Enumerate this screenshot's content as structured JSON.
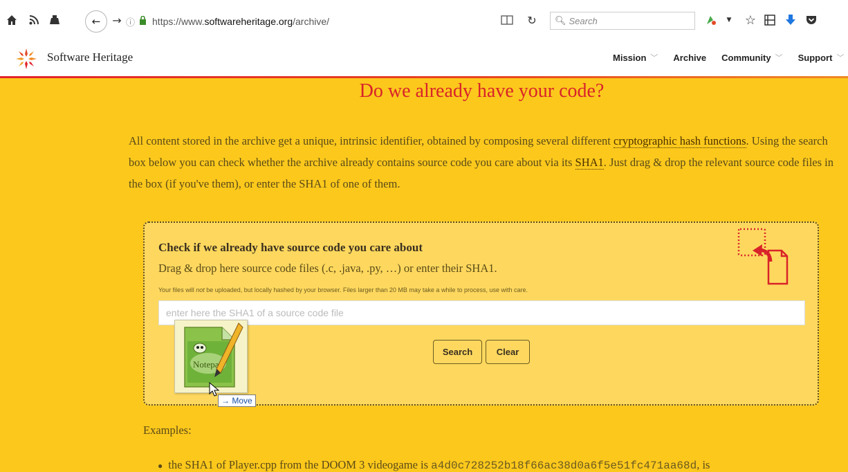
{
  "browser": {
    "url_prefix": "https://www.",
    "url_domain": "softwareheritage.org",
    "url_path": "/archive/",
    "search_placeholder": "Search",
    "icons": [
      "home-icon",
      "rss-icon",
      "user-icon",
      "back-icon",
      "forward-icon",
      "info-icon",
      "lock-icon",
      "reader-view-icon",
      "reload-icon",
      "search-icon",
      "extension-icon",
      "dropdown-icon",
      "bookmark-star-icon",
      "library-icon",
      "download-icon",
      "pocket-icon"
    ]
  },
  "site": {
    "brand": "Software Heritage",
    "nav": [
      {
        "label": "Mission",
        "has_menu": true
      },
      {
        "label": "Archive",
        "has_menu": false
      },
      {
        "label": "Community",
        "has_menu": true
      },
      {
        "label": "Support",
        "has_menu": true
      }
    ]
  },
  "page": {
    "title": "Do we already have your code?",
    "intro_1": "All content stored in the archive get a unique, intrinsic identifier, obtained by composing several different",
    "intro_link_1": "cryptographic hash functions",
    "intro_2": ". Using the search box below you can check whether the archive already contains source code you care about via its",
    "intro_link_2": "SHA1",
    "intro_3": ". Just drag & drop the relevant source code files in the box (if you've them), or enter the SHA1 of one of them.",
    "dropbox": {
      "title": "Check if we already have source code you care about",
      "subtitle": "Drag & drop here source code files (.c, .java, .py, …) or enter their SHA1.",
      "note_1": "Your files will",
      "note_em": "not",
      "note_2": "be uploaded, but locally hashed by your browser. Files larger than 20 MB may take a while to process, use with care.",
      "input_placeholder": "enter here the SHA1 of a source code file",
      "search_button": "Search",
      "clear_button": "Clear"
    },
    "drag_tooltip": "→ Move",
    "examples_label": "Examples:",
    "example_1_prefix": "the SHA1 of Player.cpp from the DOOM 3 videogame is",
    "example_1_hash": "a4d0c728252b18f66ac38d0a6f5e51fc471aa68d",
    "example_1_suffix": ", is"
  },
  "colors": {
    "background": "#fcc81c",
    "title_red": "#d8232a",
    "dropbox_bg": "#fed85e",
    "text_brown": "#5a4a18"
  }
}
